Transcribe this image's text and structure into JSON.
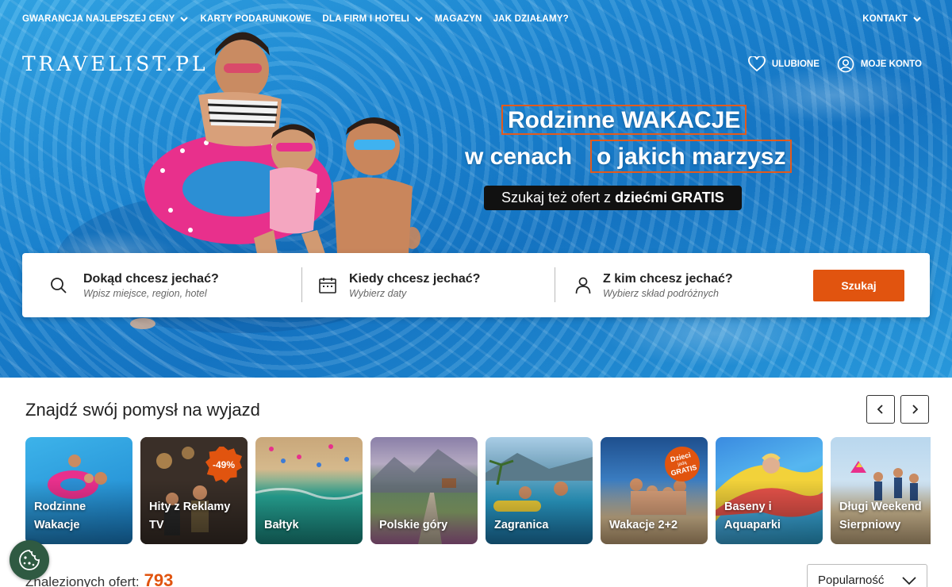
{
  "nav": {
    "items": [
      {
        "label": "GWARANCJA NAJLEPSZEJ CENY",
        "dropdown": true
      },
      {
        "label": "KARTY PODARUNKOWE",
        "dropdown": false
      },
      {
        "label": "DLA FIRM I HOTELI",
        "dropdown": true
      },
      {
        "label": "MAGAZYN",
        "dropdown": false
      },
      {
        "label": "JAK DZIAŁAMY?",
        "dropdown": false
      }
    ],
    "contact": "KONTAKT"
  },
  "brand": {
    "logo": "TRAVELIST.PL"
  },
  "user": {
    "favorites": "ULUBIONE",
    "account": "MOJE KONTO"
  },
  "hero": {
    "line1": "Rodzinne WAKACJE",
    "line2a": "w cenach",
    "line2b": "o jakich marzysz",
    "pill_normal": "Szukaj też ofert z ",
    "pill_bold": "dziećmi GRATIS"
  },
  "search": {
    "where_title": "Dokąd chcesz jechać?",
    "where_sub": "Wpisz miejsce, region, hotel",
    "when_title": "Kiedy chcesz jechać?",
    "when_sub": "Wybierz daty",
    "who_title": "Z kim chcesz jechać?",
    "who_sub": "Wybierz skład podróżnych",
    "button": "Szukaj"
  },
  "section": {
    "title": "Znajdź swój pomysł na wyjazd"
  },
  "categories": [
    {
      "line1": "Rodzinne",
      "line2": "Wakacje"
    },
    {
      "line1": "Hity z Reklamy",
      "line2": "TV",
      "badge": "-49%"
    },
    {
      "line1": "Bałtyk",
      "line2": ""
    },
    {
      "line1": "Polskie góry",
      "line2": ""
    },
    {
      "line1": "Zagranica",
      "line2": ""
    },
    {
      "line1": "Wakacje 2+2",
      "line2": "",
      "badge_lines": [
        "Dzieci",
        "jadą",
        "GRATIS"
      ]
    },
    {
      "line1": "Baseny i",
      "line2": "Aquaparki"
    },
    {
      "line1": "Długi Weekend",
      "line2": "Sierpniowy"
    }
  ],
  "results": {
    "label": "Znalezionych ofert:",
    "count": "793"
  },
  "sort": {
    "selected": "Popularność"
  },
  "colors": {
    "accent": "#e1540f",
    "headline_frame": "#e35a1c",
    "cookie_bg": "#2f5a42"
  }
}
